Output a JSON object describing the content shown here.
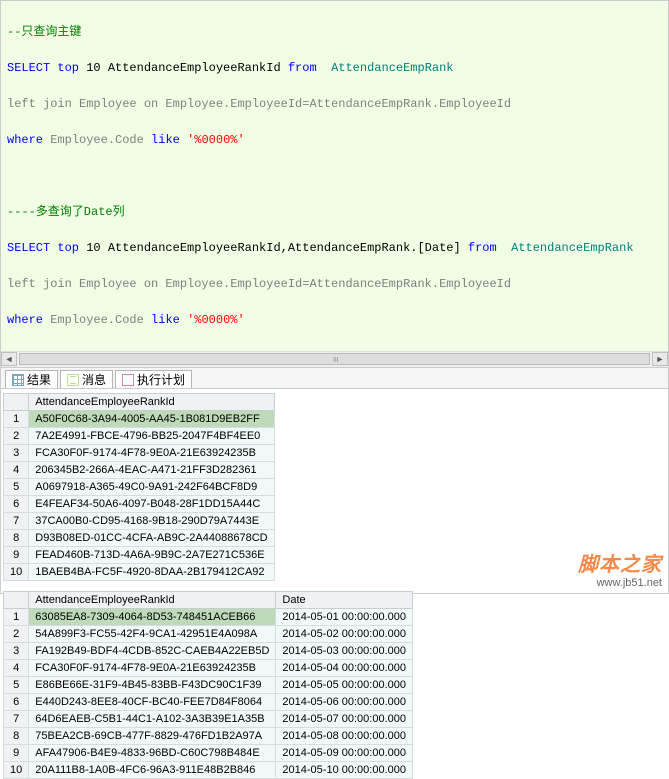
{
  "sql": {
    "comment1": "--只查询主键",
    "q1_line1": {
      "prefix": "SELECT top ",
      "num": "10",
      "mid": " AttendanceEmployeeRankId ",
      "from": "from  ",
      "tbl": "AttendanceEmpRank"
    },
    "q1_line2": {
      "gray": "left join Employee on Employee.EmployeeId=AttendanceEmpRank.EmployeeId"
    },
    "q1_line3": {
      "where": "where ",
      "gray": "Employee.Code ",
      "like": "like ",
      "str": "'%0000%'"
    },
    "comment2": "----多查询了Date列",
    "q2_line1": {
      "prefix": "SELECT top ",
      "num": "10",
      "mid": " AttendanceEmployeeRankId,AttendanceEmpRank.[Date] ",
      "from": "from  ",
      "tbl": "AttendanceEmpRank"
    },
    "q2_line2": {
      "gray": "left join Employee on Employee.EmployeeId=AttendanceEmpRank.EmployeeId"
    },
    "q2_line3": {
      "where": "where ",
      "gray": "Employee.Code ",
      "like": "like ",
      "str": "'%0000%'"
    }
  },
  "tabs": {
    "results": "结果",
    "messages": "消息",
    "plan": "执行计划"
  },
  "grid1": {
    "header": [
      "AttendanceEmployeeRankId"
    ],
    "rows": [
      [
        "A50F0C68-3A94-4005-AA45-1B081D9EB2FF"
      ],
      [
        "7A2E4991-FBCE-4796-BB25-2047F4BF4EE0"
      ],
      [
        "FCA30F0F-9174-4F78-9E0A-21E63924235B"
      ],
      [
        "206345B2-266A-4EAC-A471-21FF3D282361"
      ],
      [
        "A0697918-A365-49C0-9A91-242F64BCF8D9"
      ],
      [
        "E4FEAF34-50A6-4097-B048-28F1DD15A44C"
      ],
      [
        "37CA00B0-CD95-4168-9B18-290D79A7443E"
      ],
      [
        "D93B08ED-01CC-4CFA-AB9C-2A44088678CD"
      ],
      [
        "FEAD460B-713D-4A6A-9B9C-2A7E271C536E"
      ],
      [
        "1BAEB4BA-FC5F-4920-8DAA-2B179412CA92"
      ]
    ]
  },
  "grid2": {
    "header": [
      "AttendanceEmployeeRankId",
      "Date"
    ],
    "rows": [
      [
        "63085EA8-7309-4064-8D53-748451ACEB66",
        "2014-05-01 00:00:00.000"
      ],
      [
        "54A899F3-FC55-42F4-9CA1-42951E4A098A",
        "2014-05-02 00:00:00.000"
      ],
      [
        "FA192B49-BDF4-4CDB-852C-CAEB4A22EB5D",
        "2014-05-03 00:00:00.000"
      ],
      [
        "FCA30F0F-9174-4F78-9E0A-21E63924235B",
        "2014-05-04 00:00:00.000"
      ],
      [
        "E86BE66E-31F9-4B45-83BB-F43DC90C1F39",
        "2014-05-05 00:00:00.000"
      ],
      [
        "E440D243-8EE8-40CF-BC40-FEE7D84F8064",
        "2014-05-06 00:00:00.000"
      ],
      [
        "64D6EAEB-C5B1-44C1-A102-3A3B39E1A35B",
        "2014-05-07 00:00:00.000"
      ],
      [
        "75BEA2CB-69CB-477F-8829-476FD1B2A97A",
        "2014-05-08 00:00:00.000"
      ],
      [
        "AFA47906-B4E9-4833-96BD-C60C798B484E",
        "2014-05-09 00:00:00.000"
      ],
      [
        "20A111B8-1A0B-4FC6-96A3-911E48B2B846",
        "2014-05-10 00:00:00.000"
      ]
    ]
  },
  "watermark": {
    "main": "脚本之家",
    "sub": "www.jb51.net"
  }
}
